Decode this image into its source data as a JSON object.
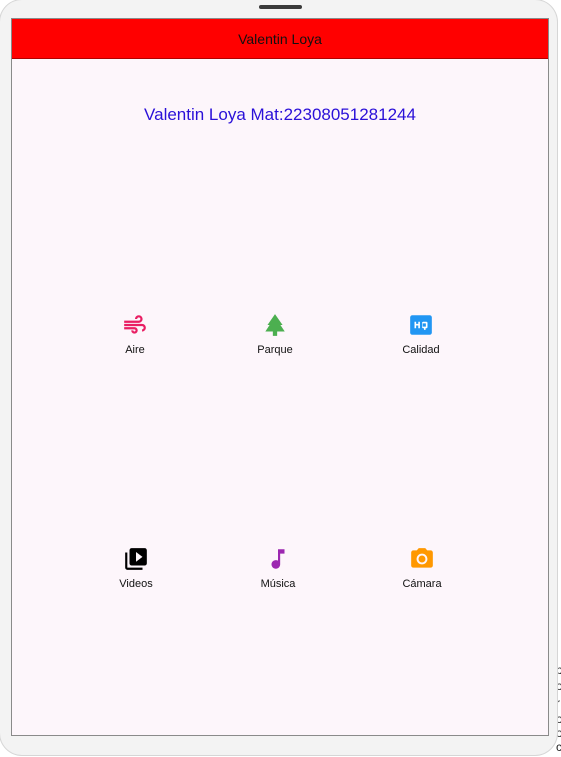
{
  "window": {
    "edge_fragments": [
      "o",
      "p",
      "o",
      "r",
      "o",
      "o",
      "c"
    ]
  },
  "appbar": {
    "title": "Valentin Loya",
    "color": "#ff0000"
  },
  "main": {
    "headline": "Valentin Loya Mat:22308051281244",
    "headline_color": "#2a10d8",
    "background": "#fdf6fb"
  },
  "grid": {
    "items": [
      {
        "label": "Aire",
        "icon": "air-icon",
        "color": "#e91e63"
      },
      {
        "label": "Parque",
        "icon": "park-icon",
        "color": "#4caf50"
      },
      {
        "label": "Calidad",
        "icon": "hq-icon",
        "color": "#2196f3"
      },
      {
        "label": "Videos",
        "icon": "video-library-icon",
        "color": "#000000"
      },
      {
        "label": "Música",
        "icon": "music-note-icon",
        "color": "#9c27b0"
      },
      {
        "label": "Cámara",
        "icon": "camera-icon",
        "color": "#ff9800"
      }
    ]
  }
}
